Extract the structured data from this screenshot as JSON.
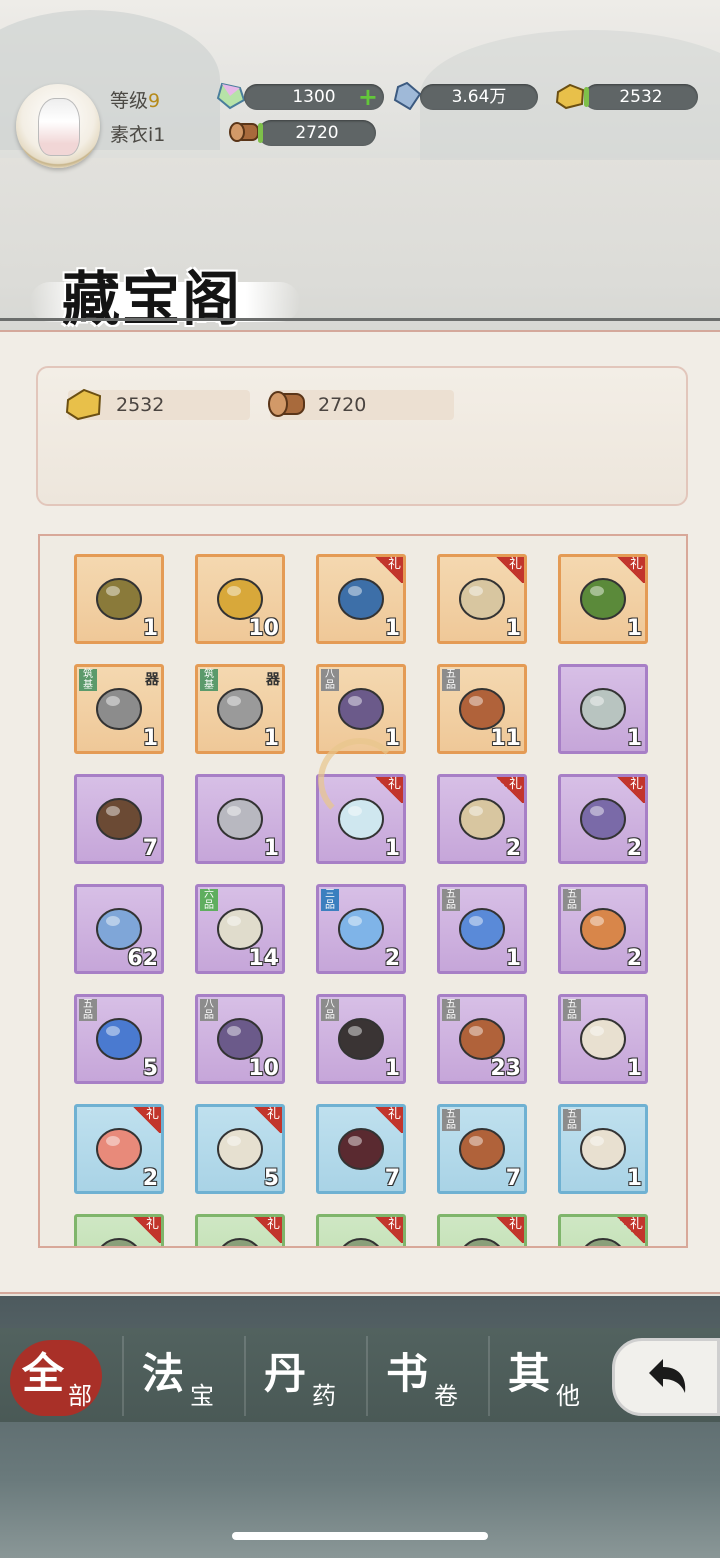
{
  "player": {
    "level_label": "等级",
    "level": "9",
    "name": "素衣i1"
  },
  "resources": {
    "jade": "1300",
    "stone": "3.64万",
    "gold": "2532",
    "wood": "2720"
  },
  "page_title": "藏宝阁",
  "currencies": {
    "gold": "2532",
    "wood": "2720"
  },
  "items": [
    {
      "color": "orange",
      "count": "1",
      "icon": "treasure-chest-icon",
      "tag": "",
      "grade": ""
    },
    {
      "color": "orange",
      "count": "10",
      "icon": "golden-key-icon",
      "tag": "",
      "grade": ""
    },
    {
      "color": "orange",
      "count": "1",
      "icon": "blue-lamp-icon",
      "tag": "礼",
      "grade": ""
    },
    {
      "color": "orange",
      "count": "1",
      "icon": "scroll-painting-icon",
      "tag": "礼",
      "grade": ""
    },
    {
      "color": "orange",
      "count": "1",
      "icon": "gift-bundle-icon",
      "tag": "礼",
      "grade": ""
    },
    {
      "color": "orange",
      "count": "1",
      "icon": "spear-icon",
      "tag": "",
      "grade": "",
      "ltag": "筑基",
      "rtag": "器"
    },
    {
      "color": "orange",
      "count": "1",
      "icon": "sword-icon",
      "tag": "",
      "grade": "",
      "ltag": "筑基",
      "rtag": "器"
    },
    {
      "color": "orange",
      "count": "1",
      "icon": "orb-on-mat-icon",
      "tag": "",
      "grade": "八品"
    },
    {
      "color": "orange",
      "count": "11",
      "icon": "pill-icon",
      "tag": "",
      "grade": "五品"
    },
    {
      "color": "purple",
      "count": "1",
      "icon": "silver-chest-icon",
      "tag": "",
      "grade": ""
    },
    {
      "color": "purple",
      "count": "7",
      "icon": "wooden-chest-icon",
      "tag": "",
      "grade": ""
    },
    {
      "color": "purple",
      "count": "1",
      "icon": "silver-keys-icon",
      "tag": "",
      "grade": ""
    },
    {
      "color": "purple",
      "count": "1",
      "icon": "crystal-ore-icon",
      "tag": "礼",
      "grade": ""
    },
    {
      "color": "purple",
      "count": "2",
      "icon": "scroll-painting-icon",
      "tag": "礼",
      "grade": ""
    },
    {
      "color": "purple",
      "count": "2",
      "icon": "lotus-flower-icon",
      "tag": "礼",
      "grade": ""
    },
    {
      "color": "purple",
      "count": "62",
      "icon": "cards-icon",
      "tag": "",
      "grade": ""
    },
    {
      "color": "purple",
      "count": "14",
      "icon": "map-scroll-icon",
      "tag": "",
      "grade": "六品"
    },
    {
      "color": "purple",
      "count": "2",
      "icon": "blue-gem-icon",
      "tag": "",
      "grade": "三品"
    },
    {
      "color": "purple",
      "count": "1",
      "icon": "blue-orb-icon",
      "tag": "",
      "grade": "五品"
    },
    {
      "color": "purple",
      "count": "2",
      "icon": "orange-orb-icon",
      "tag": "",
      "grade": "五品"
    },
    {
      "color": "purple",
      "count": "5",
      "icon": "blue-ring-orb-icon",
      "tag": "",
      "grade": "五品"
    },
    {
      "color": "purple",
      "count": "10",
      "icon": "orb-on-mat-icon",
      "tag": "",
      "grade": "八品"
    },
    {
      "color": "purple",
      "count": "1",
      "icon": "dark-gourd-icon",
      "tag": "",
      "grade": "八品"
    },
    {
      "color": "purple",
      "count": "23",
      "icon": "pill-icon",
      "tag": "",
      "grade": "五品"
    },
    {
      "color": "purple",
      "count": "1",
      "icon": "white-gourd-icon",
      "tag": "",
      "grade": "五品"
    },
    {
      "color": "blue",
      "count": "2",
      "icon": "peach-icon",
      "tag": "礼",
      "grade": ""
    },
    {
      "color": "blue",
      "count": "5",
      "icon": "scroll-icon",
      "tag": "礼",
      "grade": ""
    },
    {
      "color": "blue",
      "count": "7",
      "icon": "dark-flower-icon",
      "tag": "礼",
      "grade": ""
    },
    {
      "color": "blue",
      "count": "7",
      "icon": "pill-icon",
      "tag": "",
      "grade": "五品"
    },
    {
      "color": "blue",
      "count": "1",
      "icon": "white-gourd-icon",
      "tag": "",
      "grade": "五品"
    },
    {
      "color": "green",
      "count": "",
      "icon": "item-icon",
      "tag": "礼",
      "grade": ""
    },
    {
      "color": "green",
      "count": "",
      "icon": "item-icon",
      "tag": "礼",
      "grade": ""
    },
    {
      "color": "green",
      "count": "",
      "icon": "item-icon",
      "tag": "礼",
      "grade": ""
    },
    {
      "color": "green",
      "count": "",
      "icon": "item-icon",
      "tag": "礼",
      "grade": ""
    },
    {
      "color": "green",
      "count": "",
      "icon": "item-icon",
      "tag": "礼",
      "grade": ""
    }
  ],
  "tabs": [
    {
      "big": "全",
      "small": "部",
      "active": true
    },
    {
      "big": "法",
      "small": "宝",
      "active": false
    },
    {
      "big": "丹",
      "small": "药",
      "active": false
    },
    {
      "big": "书",
      "small": "卷",
      "active": false
    },
    {
      "big": "其",
      "small": "他",
      "active": false
    }
  ],
  "colors": {
    "tab_active": "#a93028",
    "cell_orange": "#e49b55",
    "cell_purple": "#a77fc6",
    "cell_blue": "#6fb1d2",
    "tag_red": "#c2352c"
  }
}
